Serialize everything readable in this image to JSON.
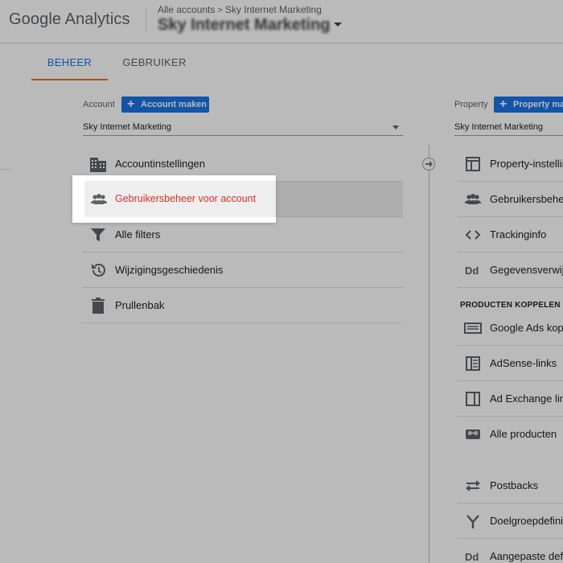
{
  "header": {
    "logo": "Google Analytics",
    "breadcrumb": {
      "all_accounts": "Alle accounts",
      "separator": ">",
      "account": "Sky Internet Marketing"
    },
    "account_title": "Sky Internet Marketing"
  },
  "tabs": [
    {
      "label": "BEHEER",
      "active": true
    },
    {
      "label": "GEBRUIKER",
      "active": false
    }
  ],
  "account_column": {
    "label": "Account",
    "create_button": "Account maken",
    "selector_value": "Sky Internet Marketing",
    "items": [
      {
        "label": "Accountinstellingen",
        "icon": "building-icon"
      },
      {
        "label": "Gebruikersbeheer voor account",
        "icon": "users-icon",
        "active": true
      },
      {
        "label": "Alle filters",
        "icon": "filter-icon"
      },
      {
        "label": "Wijzigingsgeschiedenis",
        "icon": "history-icon"
      },
      {
        "label": "Prullenbak",
        "icon": "trash-icon"
      }
    ]
  },
  "property_column": {
    "label": "Property",
    "create_button": "Property maken",
    "selector_value": "Sky Internet Marketing",
    "items": [
      {
        "label": "Property-instellingen",
        "icon": "property-settings-icon"
      },
      {
        "label": "Gebruikersbeheer voor property",
        "icon": "users-icon"
      },
      {
        "label": "Trackinginfo",
        "icon": "code-icon"
      },
      {
        "label": "Gegevensverwijdering",
        "icon": "dd-icon"
      }
    ],
    "section_heading": "PRODUCTEN KOPPELEN",
    "link_items": [
      {
        "label": "Google Ads koppelen",
        "icon": "ads-icon"
      },
      {
        "label": "AdSense-links",
        "icon": "adsense-icon"
      },
      {
        "label": "Ad Exchange links",
        "icon": "ad-exchange-icon"
      },
      {
        "label": "Alle producten",
        "icon": "link-icon"
      }
    ],
    "more_items": [
      {
        "label": "Postbacks",
        "icon": "postbacks-icon"
      },
      {
        "label": "Doelgroepdefinities",
        "icon": "audience-icon"
      },
      {
        "label": "Aangepaste definities",
        "icon": "dd-icon"
      }
    ]
  },
  "colors": {
    "accent": "#1a73e8",
    "active_tab_underline": "#e8710a",
    "active_item_text": "#d93025"
  }
}
